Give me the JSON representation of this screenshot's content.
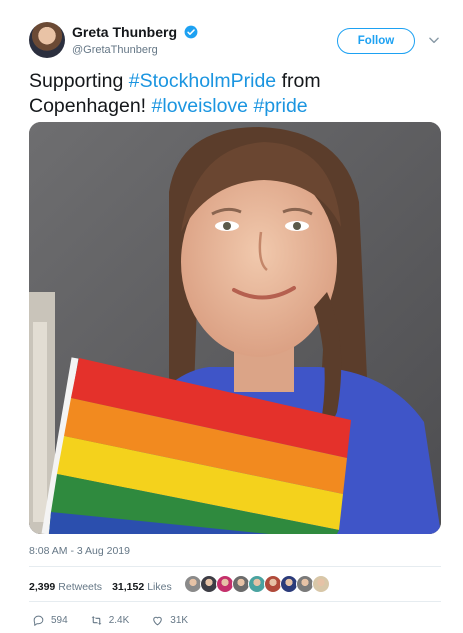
{
  "author": {
    "name": "Greta Thunberg",
    "handle": "@GretaThunberg",
    "verified_icon": "verified-badge-icon"
  },
  "header": {
    "follow_label": "Follow",
    "menu_icon": "chevron-down-icon"
  },
  "tweet": {
    "segments": [
      {
        "text": "Supporting ",
        "type": "text"
      },
      {
        "text": "#StockholmPride",
        "type": "hashtag"
      },
      {
        "text": " from Copenhagen! ",
        "type": "text"
      },
      {
        "text": "#loveislove",
        "type": "hashtag"
      },
      {
        "text": " ",
        "type": "text"
      },
      {
        "text": "#pride",
        "type": "hashtag"
      }
    ],
    "hashtag_color": "#1b95e0"
  },
  "timestamp": "8:08 AM - 3 Aug 2019",
  "stats": {
    "retweets_count": "2,399",
    "retweets_label": "Retweets",
    "likes_count": "31,152",
    "likes_label": "Likes",
    "liker_colors": [
      "#8a8a8a",
      "#3d3d45",
      "#c4306b",
      "#6b6b6b",
      "#4aa3a0",
      "#b04a3a",
      "#2b3b7a",
      "#7a7a7a",
      "#d8c7a8"
    ]
  },
  "actions": {
    "reply_count": "594",
    "retweet_count": "2.4K",
    "like_count": "31K"
  },
  "colors": {
    "accent": "#1da1f2",
    "secondary_text": "#657786",
    "divider": "#e6ecf0"
  }
}
